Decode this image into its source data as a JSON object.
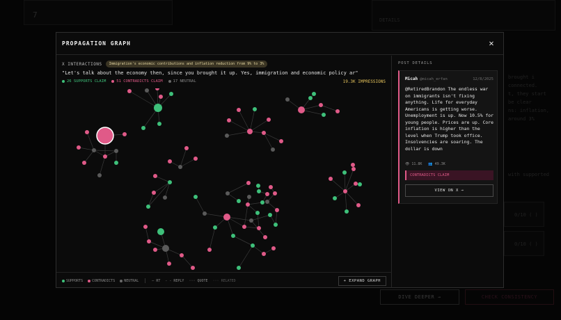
{
  "background": {
    "card_number": "7",
    "details_label": "DETAILS",
    "side_text_lines": [
      "brought i",
      "connected.",
      "t, they start",
      "be clear",
      "ns: inflation,",
      "around 3%"
    ],
    "supported_text": "with supported",
    "score_1": "0/10 ( )",
    "score_2": "0/10 ( )",
    "dive_deeper_label": "DIVE DEEPER →",
    "check_consistency_label": "CHECK CONSISTENCY"
  },
  "modal": {
    "title": "PROPAGATION GRAPH",
    "close_icon": "close-icon",
    "interactions_label": "X INTERACTIONS",
    "claim_label": "Immigration's economic contributions and inflation reduction from 9% to 3%",
    "quote": "\"Let's talk about the economy then, since you brought it up. Yes, immigration and economic policy ar\"",
    "supports_count": "26 SUPPORTS CLAIM",
    "contradicts_count": "51 CONTRADICTS CLAIM",
    "neutral_count": "17 NEUTRAL",
    "impressions": "19.3K IMPRESSIONS",
    "colors": {
      "supports": "#3ec07a",
      "contradicts": "#e05a88",
      "neutral": "#5a5a5a",
      "accent": "#e6c45c"
    },
    "legend": {
      "supports": "SUPPORTS",
      "contradicts": "CONTRADICTS",
      "neutral": "NEUTRAL",
      "rt": "— RT",
      "reply": "- - REPLY",
      "quote": "··· QUOTE",
      "related": "··· RELATED"
    },
    "expand_label": "+ EXPAND GRAPH"
  },
  "post": {
    "section_title": "POST DETAILS",
    "author_name": "Micah",
    "author_handle": "@micah_erfan",
    "date": "12/8/2025",
    "body": "@RetiredBrandon The endless war on immigrants isn't fixing anything. Life for everyday Americans is getting worse. Unemployment is up. Now 10.5% for young people. Prices are up. Core inflation is higher than the level when Trump took office. Insolvencies are soaring. The dollar is down",
    "views": "11.8K",
    "followers": "49.3K",
    "stance": "CONTRADICTS CLAIM",
    "view_button": "VIEW ON X →"
  }
}
